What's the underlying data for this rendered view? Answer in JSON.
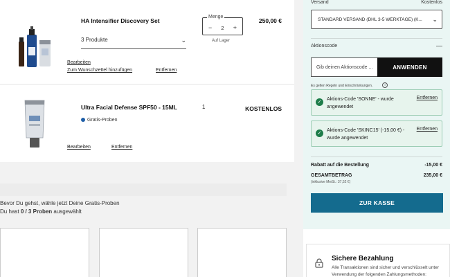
{
  "cart": {
    "items": [
      {
        "title": "HA Intensifier Discovery Set",
        "variant": "3 Produkte",
        "qty_label": "Menge",
        "qty_minus": "−",
        "qty": "2",
        "qty_plus": "+",
        "stock": "Auf Lager",
        "price": "250,00 €",
        "edit": "Bearbeiten",
        "wishlist": "Zum Wunschzettel hinzufügen",
        "remove": "Entfernen"
      },
      {
        "title": "Ultra Facial Defense SPF50 - 15ML",
        "badge": "Gratis-Proben",
        "qty": "1",
        "price": "KOSTENLOS",
        "edit": "Bearbeiten",
        "remove": "Entfernen"
      }
    ]
  },
  "samples": {
    "intro": "Bevor Du gehst, wähle jetzt Deine Gratis-Proben",
    "count_prefix": "Du hast",
    "count": "0 / 3 Proben",
    "count_suffix": "ausgewählt",
    "plus": "+"
  },
  "summary": {
    "shipping_label": "Versand",
    "shipping_cost_label": "Kostenlos",
    "shipping_value": "STANDARD VERSAND (DHL 3-5 WERKTAGE) (K...",
    "coupon_title": "Aktionscode",
    "coupon_collapse": "—",
    "coupon_placeholder": "Gib deinen Aktionscode ...",
    "apply": "ANWENDEN",
    "rules_note": "Es gelten Regeln und Einschränkungen.",
    "codes": [
      {
        "text": "Aktions-Code 'SONNE' - wurde angewendet",
        "remove": "Entfernen"
      },
      {
        "text": "Aktions-Code 'SKINC15' (-15,00 €) - wurde angewendet",
        "remove": "Entfernen"
      }
    ],
    "discount_label": "Rabatt auf die Bestellung",
    "discount_value": "-15,00 €",
    "total_label": "GESAMTBETRAG",
    "total_value": "235,00 €",
    "vat_note": "(inklusive MwSt.: 37,52 €)",
    "checkout": "ZUR KASSE"
  },
  "secure": {
    "title": "Sichere Bezahlung",
    "text": "Alle Transaktionen sind sicher und verschlüsselt unter Verwendung der folgenden Zahlungsmethoden:"
  }
}
